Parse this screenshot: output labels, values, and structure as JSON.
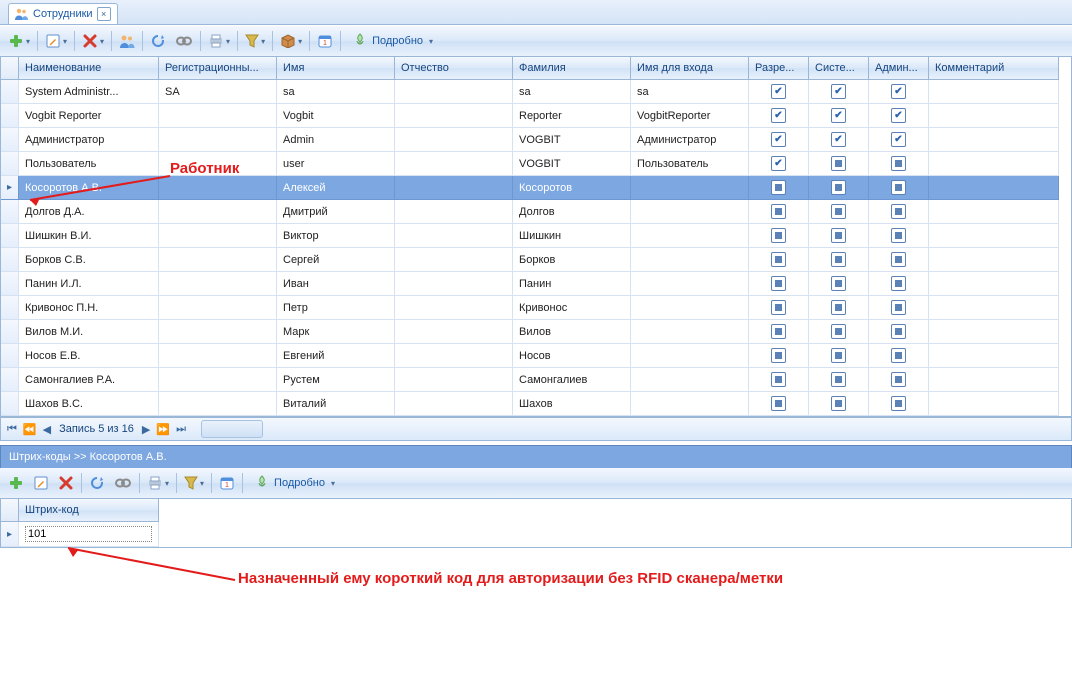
{
  "tab": {
    "title": "Сотрудники"
  },
  "toolbar1": {
    "details": "Подробно"
  },
  "columns": [
    "Наименование",
    "Регистрационны...",
    "Имя",
    "Отчество",
    "Фамилия",
    "Имя для входа",
    "Разре...",
    "Систе...",
    "Админ...",
    "Комментарий"
  ],
  "rows": [
    {
      "name": "System Administr...",
      "reg": "SA",
      "first": "sa",
      "mid": "",
      "last": "sa",
      "login": "sa",
      "perm": "check",
      "sys": "check",
      "admin": "check"
    },
    {
      "name": "Vogbit Reporter",
      "reg": "",
      "first": "Vogbit",
      "mid": "",
      "last": "Reporter",
      "login": "VogbitReporter",
      "perm": "check",
      "sys": "check",
      "admin": "check"
    },
    {
      "name": "Администратор",
      "reg": "",
      "first": "Admin",
      "mid": "",
      "last": "VOGBIT",
      "login": "Администратор",
      "perm": "check",
      "sys": "check",
      "admin": "check"
    },
    {
      "name": "Пользователь",
      "reg": "",
      "first": "user",
      "mid": "",
      "last": "VOGBIT",
      "login": "Пользователь",
      "perm": "check",
      "sys": "sq",
      "admin": "sq"
    },
    {
      "name": "Косоротов А.В.",
      "reg": "",
      "first": "Алексей",
      "mid": "",
      "last": "Косоротов",
      "login": "",
      "perm": "sq",
      "sys": "sq",
      "admin": "sq",
      "sel": true
    },
    {
      "name": "Долгов Д.А.",
      "reg": "",
      "first": "Дмитрий",
      "mid": "",
      "last": "Долгов",
      "login": "",
      "perm": "sq",
      "sys": "sq",
      "admin": "sq"
    },
    {
      "name": "Шишкин В.И.",
      "reg": "",
      "first": "Виктор",
      "mid": "",
      "last": "Шишкин",
      "login": "",
      "perm": "sq",
      "sys": "sq",
      "admin": "sq"
    },
    {
      "name": "Борков С.В.",
      "reg": "",
      "first": "Сергей",
      "mid": "",
      "last": "Борков",
      "login": "",
      "perm": "sq",
      "sys": "sq",
      "admin": "sq"
    },
    {
      "name": "Панин И.Л.",
      "reg": "",
      "first": "Иван",
      "mid": "",
      "last": "Панин",
      "login": "",
      "perm": "sq",
      "sys": "sq",
      "admin": "sq"
    },
    {
      "name": "Кривонос П.Н.",
      "reg": "",
      "first": "Петр",
      "mid": "",
      "last": "Кривонос",
      "login": "",
      "perm": "sq",
      "sys": "sq",
      "admin": "sq"
    },
    {
      "name": "Вилов М.И.",
      "reg": "",
      "first": "Марк",
      "mid": "",
      "last": "Вилов",
      "login": "",
      "perm": "sq",
      "sys": "sq",
      "admin": "sq"
    },
    {
      "name": "Носов Е.В.",
      "reg": "",
      "first": "Евгений",
      "mid": "",
      "last": "Носов",
      "login": "",
      "perm": "sq",
      "sys": "sq",
      "admin": "sq"
    },
    {
      "name": "Самонгалиев Р.А.",
      "reg": "",
      "first": "Рустем",
      "mid": "",
      "last": "Самонгалиев",
      "login": "",
      "perm": "sq",
      "sys": "sq",
      "admin": "sq"
    },
    {
      "name": "Шахов В.С.",
      "reg": "",
      "first": "Виталий",
      "mid": "",
      "last": "Шахов",
      "login": "",
      "perm": "sq",
      "sys": "sq",
      "admin": "sq"
    }
  ],
  "nav": {
    "text": "Запись 5 из 16"
  },
  "panel2": {
    "title": "Штрих-коды >> Косоротов А.В.",
    "details": "Подробно",
    "column": "Штрих-код",
    "value": "101"
  },
  "anno1": "Работник",
  "anno2": "Назначенный ему короткий код для авторизации без RFID сканера/метки"
}
